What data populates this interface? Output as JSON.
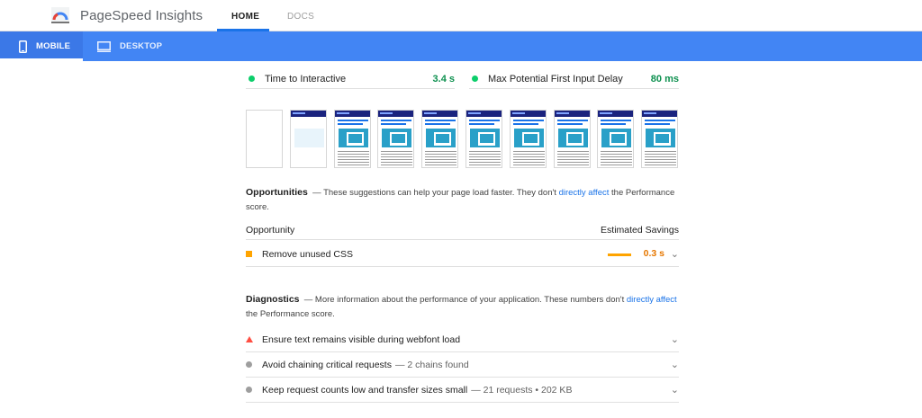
{
  "header": {
    "brand": "PageSpeed Insights",
    "tabs": [
      {
        "label": "HOME",
        "active": true
      },
      {
        "label": "DOCS",
        "active": false
      }
    ]
  },
  "device_tabs": [
    {
      "label": "MOBILE",
      "icon": "phone-icon",
      "active": true
    },
    {
      "label": "DESKTOP",
      "icon": "monitor-icon",
      "active": false
    }
  ],
  "metrics": [
    {
      "label": "Time to Interactive",
      "value": "3.4 s",
      "status_color": "#0cce6b"
    },
    {
      "label": "Max Potential First Input Delay",
      "value": "80 ms",
      "status_color": "#0cce6b"
    }
  ],
  "filmstrip": {
    "frames": [
      "blank",
      "partial",
      "loaded",
      "loaded",
      "loaded",
      "loaded",
      "loaded",
      "loaded",
      "loaded",
      "loaded"
    ]
  },
  "opportunities": {
    "heading": "Opportunities",
    "desc_before": "— These suggestions can help your page load faster. They don't",
    "link": "directly affect",
    "desc_after": "the Performance score.",
    "col_left": "Opportunity",
    "col_right": "Estimated Savings",
    "items": [
      {
        "title": "Remove unused CSS",
        "savings": "0.3 s",
        "status_color": "#ffa400"
      }
    ]
  },
  "diagnostics": {
    "heading": "Diagnostics",
    "desc_before": "— More information about the performance of your application. These numbers don't",
    "link": "directly affect",
    "desc_after": "the Performance score.",
    "items": [
      {
        "title": "Ensure text remains visible during webfont load",
        "detail": "",
        "status": "fail"
      },
      {
        "title": "Avoid chaining critical requests",
        "detail": "— 2 chains found",
        "status": "info"
      },
      {
        "title": "Keep request counts low and transfer sizes small",
        "detail": "— 21 requests • 202 KB",
        "status": "info"
      }
    ]
  },
  "colors": {
    "accent": "#4285f4",
    "pass": "#0cce6b",
    "average": "#ffa400",
    "fail": "#ff4e42",
    "link": "#1a73e8"
  }
}
